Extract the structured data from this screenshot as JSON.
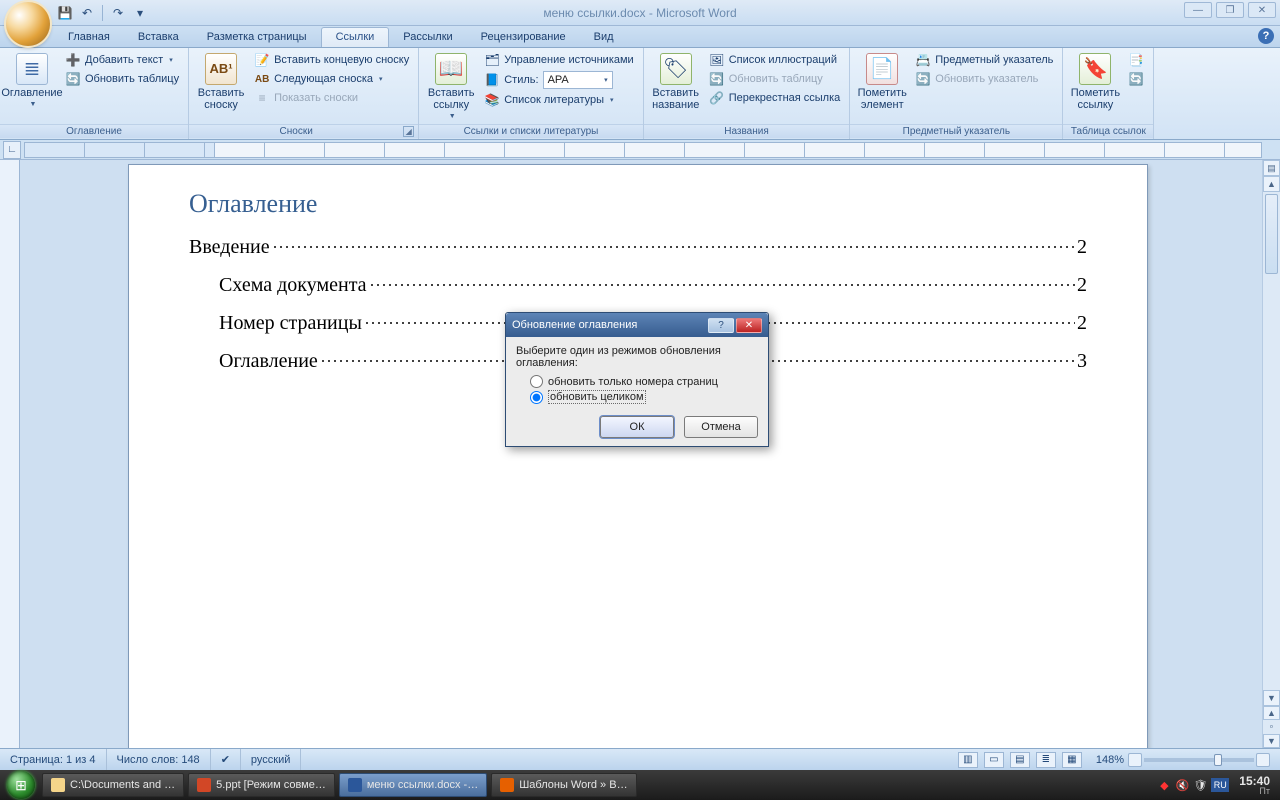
{
  "title": "меню ссылки.docx - Microsoft Word",
  "qat": {
    "save": "💾",
    "undo": "↶",
    "redo": "↷",
    "spacer": "▾"
  },
  "tabs": [
    "Главная",
    "Вставка",
    "Разметка страницы",
    "Ссылки",
    "Рассылки",
    "Рецензирование",
    "Вид"
  ],
  "activeTab": "Ссылки",
  "ribbon": {
    "g1": {
      "label": "Оглавление",
      "big": "Оглавление",
      "addText": "Добавить текст",
      "updateTable": "Обновить таблицу"
    },
    "g2": {
      "label": "Сноски",
      "big": "Вставить сноску",
      "ab": "AB¹",
      "endnote": "Вставить концевую сноску",
      "nextNote": "Следующая сноска",
      "showNotes": "Показать сноски"
    },
    "g3": {
      "label": "Ссылки и списки литературы",
      "big": "Вставить ссылку",
      "manage": "Управление источниками",
      "styleLabel": "Стиль:",
      "styleValue": "APA",
      "biblio": "Список литературы"
    },
    "g4": {
      "label": "Названия",
      "big": "Вставить название",
      "figList": "Список иллюстраций",
      "update": "Обновить таблицу",
      "crossref": "Перекрестная ссылка"
    },
    "g5": {
      "label": "Предметный указатель",
      "big": "Пометить элемент",
      "index": "Предметный указатель",
      "update": "Обновить указатель"
    },
    "g6": {
      "label": "Таблица ссылок",
      "big": "Пометить ссылку"
    }
  },
  "toc": {
    "title": "Оглавление",
    "lines": [
      {
        "text": "Введение",
        "page": "2",
        "indent": false
      },
      {
        "text": "Схема документа",
        "page": "2",
        "indent": true
      },
      {
        "text": "Номер страницы",
        "page": "2",
        "indent": true
      },
      {
        "text": "Оглавление",
        "page": "3",
        "indent": true
      }
    ]
  },
  "dialog": {
    "title": "Обновление оглавления",
    "prompt": "Выберите один из режимов обновления оглавления:",
    "opt1": "обновить только номера страниц",
    "opt2": "обновить целиком",
    "ok": "ОК",
    "cancel": "Отмена"
  },
  "status": {
    "page": "Страница: 1 из 4",
    "words": "Число слов: 148",
    "lang": "русский",
    "zoom": "148%"
  },
  "taskbar": {
    "items": [
      "C:\\Documents and …",
      "5.ppt [Режим совме…",
      "меню ссылки.docx -…",
      "Шаблоны Word » В…"
    ],
    "time": "15:40",
    "day": "Пт"
  }
}
